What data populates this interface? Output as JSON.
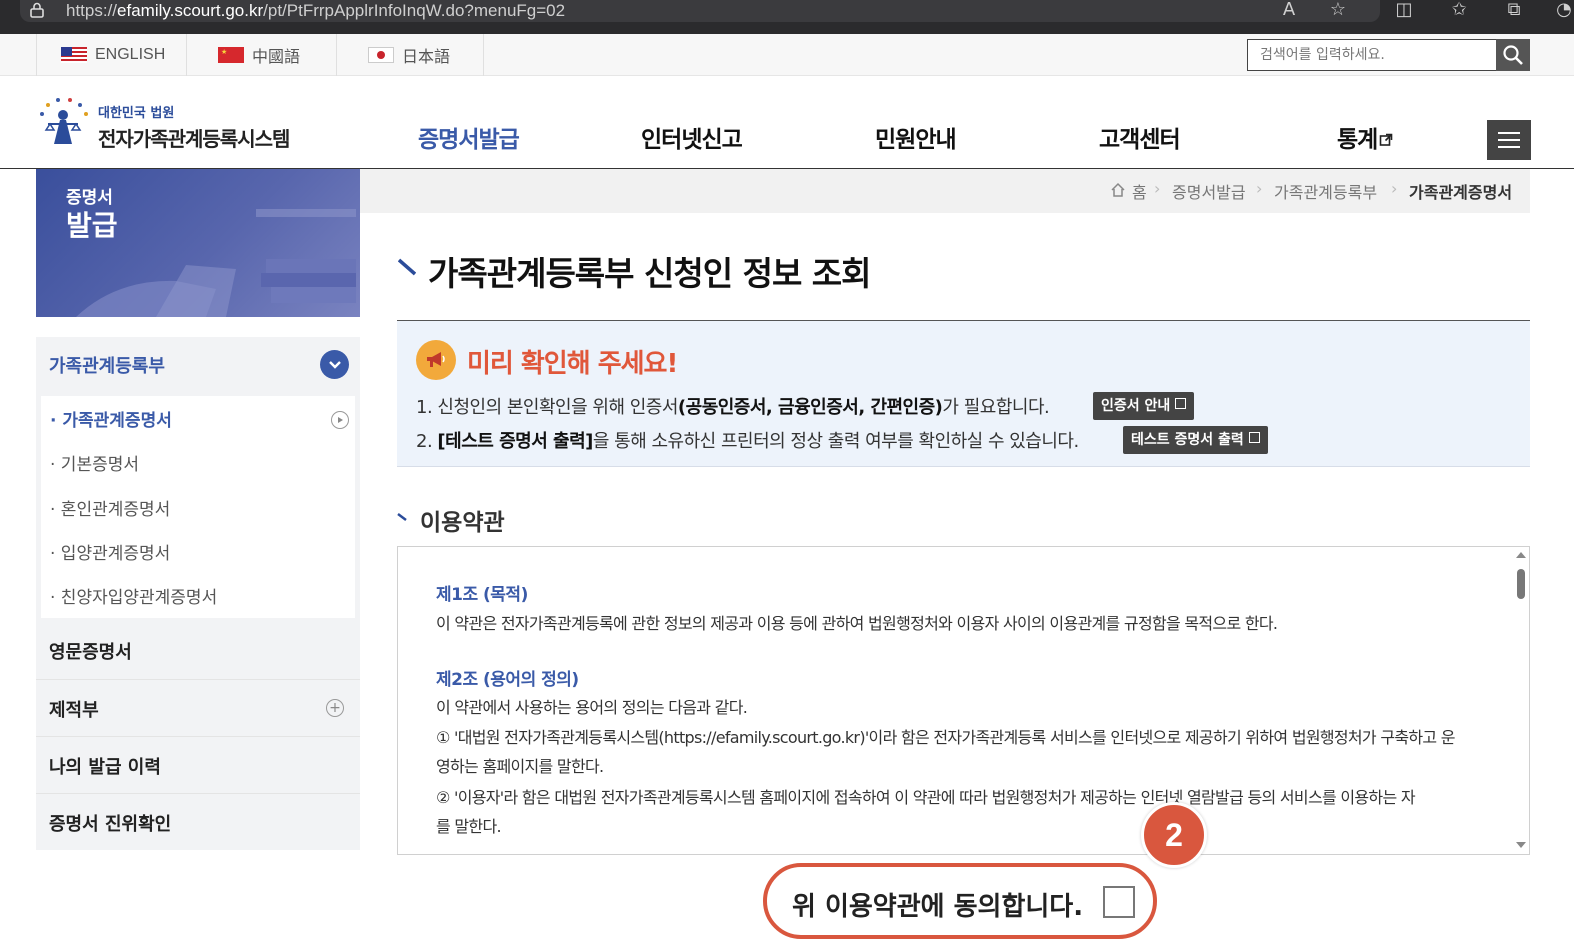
{
  "browser": {
    "url_prefix": "https://",
    "url_domain": "efamily.scourt.go.kr",
    "url_path": "/pt/PtFrrpApplrInfoInqW.do?menuFg=02"
  },
  "util": {
    "languages": [
      "ENGLISH",
      "中國語",
      "日本語"
    ],
    "search_placeholder": "검색어를 입력하세요."
  },
  "header": {
    "logo_sub": "대한민국 법원",
    "logo_main": "전자가족관계등록시스템",
    "nav": [
      "증명서발급",
      "인터넷신고",
      "민원안내",
      "고객센터",
      "통계"
    ]
  },
  "sidebar": {
    "banner_line1": "증명서",
    "banner_line2": "발급",
    "group_title": "가족관계등록부",
    "sub_items": [
      "· 가족관계증명서",
      "· 기본증명서",
      "· 혼인관계증명서",
      "· 입양관계증명서",
      "· 친양자입양관계증명서"
    ],
    "rows": [
      "영문증명서",
      "제적부",
      "나의 발급 이력",
      "증명서 진위확인"
    ]
  },
  "breadcrumb": [
    "홈",
    "증명서발급",
    "가족관계등록부",
    "가족관계증명서"
  ],
  "page_title": "가족관계등록부 신청인 정보 조회",
  "notice": {
    "title": "미리 확인해 주세요!",
    "line1_a": "1. 신청인의 본인확인을 위해 인증서",
    "line1_b": "(공동인증서, 금융인증서, 간편인증)",
    "line1_c": "가 필요합니다.",
    "line1_btn": "인증서 안내",
    "line2_a": "2. ",
    "line2_b": "[테스트 증명서 출력]",
    "line2_c": "을 통해 소유하신 프린터의 정상 출력 여부를 확인하실 수 있습니다.",
    "line2_btn": "테스트 증명서 출력"
  },
  "terms": {
    "title": "이용약관",
    "a1_head": "제1조 (목적)",
    "a1_body": "이 약관은 전자가족관계등록에 관한 정보의 제공과 이용 등에 관하여 법원행정처와 이용자 사이의 이용관계를 규정함을 목적으로 한다.",
    "a2_head": "제2조 (용어의 정의)",
    "a2_body": "이 약관에서 사용하는 용어의 정의는 다음과 같다.",
    "a2_item1_l1": "① '대법원 전자가족관계등록시스템(https://efamily.scourt.go.kr)'이라 함은 전자가족관계등록 서비스를 인터넷으로 제공하기 위하여 법원행정처가 구축하고 운",
    "a2_item1_l2": "영하는 홈페이지를 말한다.",
    "a2_item2_l1": "② '이용자'라 함은 대법원 전자가족관계등록시스템 홈페이지에 접속하여 이 약관에 따라 법원행정처가 제공하는 인터넷 열람발급 등의 서비스를 이용하는 자",
    "a2_item2_l2": "를 말한다."
  },
  "badge": "2",
  "agree_label": "위 이용약관에 동의합니다."
}
